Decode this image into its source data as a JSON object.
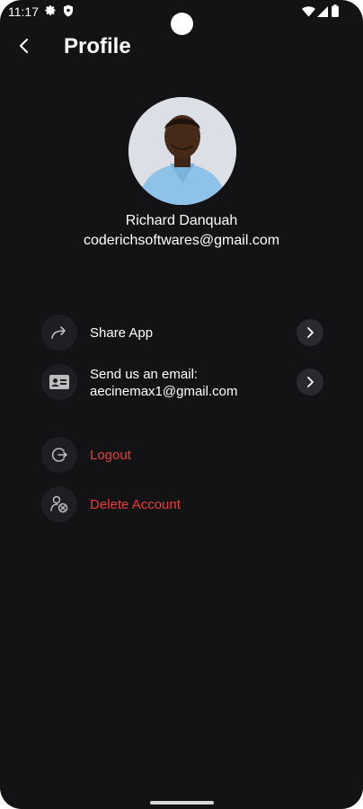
{
  "status_bar": {
    "time": "11:17",
    "icons": [
      "gear-icon",
      "shield-icon",
      "wifi-icon",
      "signal-icon",
      "battery-icon"
    ]
  },
  "app_bar": {
    "back_icon": "back-arrow-icon",
    "title": "Profile"
  },
  "profile": {
    "name": "Richard Danquah",
    "email": "coderichsoftwares@gmail.com"
  },
  "menu": {
    "share": {
      "label": "Share App",
      "icon": "share-icon",
      "chevron": "chevron-right-icon"
    },
    "email": {
      "label_line1": "Send us an email:",
      "label_line2": "aecinemax1@gmail.com",
      "icon": "contact-card-icon",
      "chevron": "chevron-right-icon"
    },
    "logout": {
      "label": "Logout",
      "icon": "logout-icon"
    },
    "delete": {
      "label": "Delete Account",
      "icon": "delete-user-icon"
    }
  },
  "colors": {
    "background": "#131215",
    "text": "#ffffff",
    "danger": "#e83d3a",
    "icon_circle": "#1f1e22"
  }
}
